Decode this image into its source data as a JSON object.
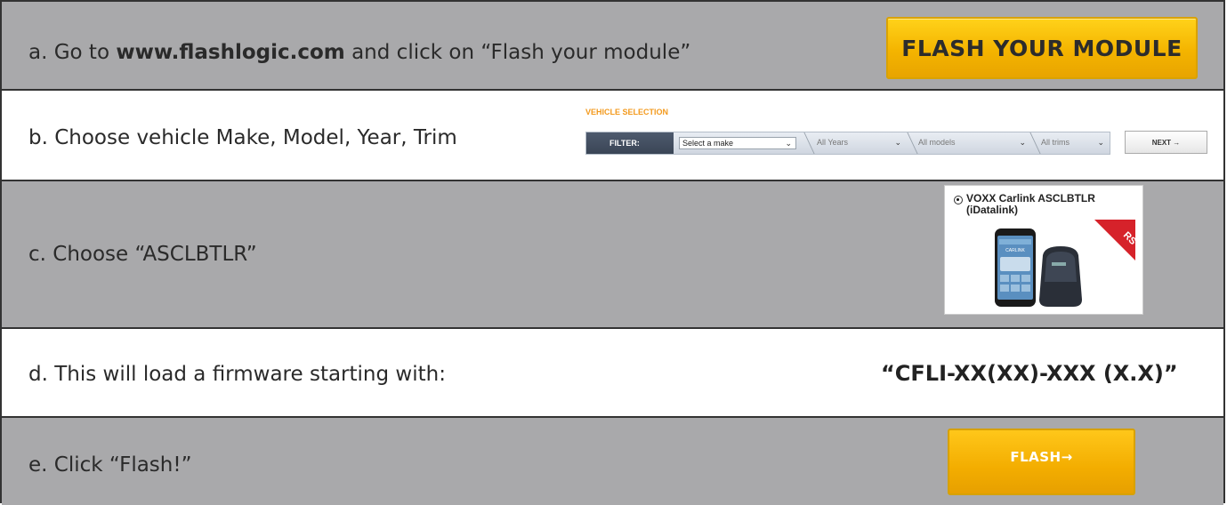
{
  "steps": {
    "a": {
      "prefix": "a. Go to ",
      "bold": "www.flashlogic.com",
      "suffix": " and click on “Flash your module”",
      "button_label": "FLASH YOUR MODULE"
    },
    "b": {
      "text": "b. Choose vehicle Make, Model, Year, Trim",
      "section_title": "VEHICLE SELECTION",
      "filter_label": "FILTER:",
      "make_select": "Select a make",
      "years_select": "All Years",
      "models_select": "All models",
      "trims_select": "All trims",
      "next_label": "NEXT →"
    },
    "c": {
      "text": "c. Choose “ASCLBTLR”",
      "product_name": "VOXX Carlink ASCLBTLR (iDatalink)",
      "corner_badge": "RS",
      "phone_label": "CARLINK"
    },
    "d": {
      "text": "d. This will load a firmware starting with:",
      "firmware": "“CFLI-XX(XX)-XXX (X.X)”"
    },
    "e": {
      "text": "e. Click “Flash!”",
      "button_label": "FLASH→"
    }
  },
  "colors": {
    "row_gray": "#a9a9ab",
    "button_yellow": "#f4b400",
    "accent_orange": "#f39a1e"
  }
}
